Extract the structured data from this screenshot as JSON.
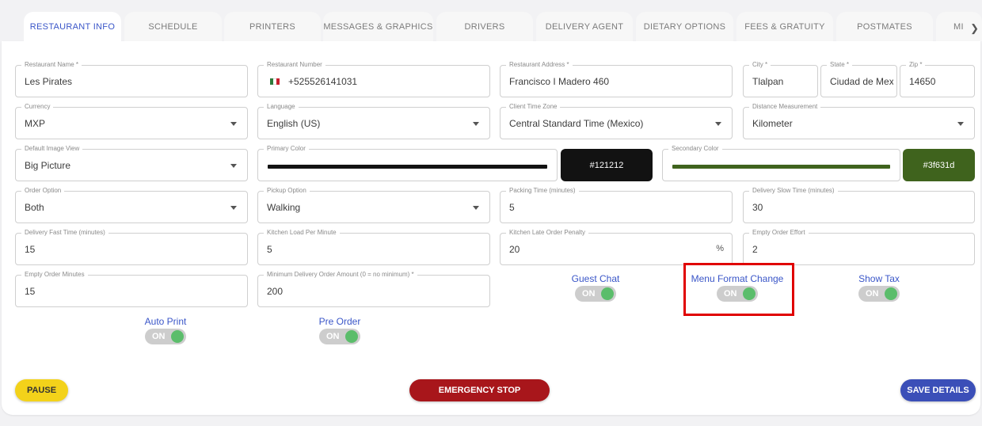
{
  "tabs": [
    {
      "label": "RESTAURANT INFO",
      "active": true
    },
    {
      "label": "SCHEDULE"
    },
    {
      "label": "PRINTERS"
    },
    {
      "label": "MESSAGES & GRAPHICS"
    },
    {
      "label": "DRIVERS"
    },
    {
      "label": "DELIVERY AGENT"
    },
    {
      "label": "DIETARY OPTIONS"
    },
    {
      "label": "FEES & GRATUITY"
    },
    {
      "label": "POSTMATES"
    },
    {
      "label": "MI"
    }
  ],
  "fields": {
    "restaurant_name": {
      "label": "Restaurant Name *",
      "value": "Les Pirates"
    },
    "restaurant_number": {
      "label": "Restaurant Number",
      "value": "+525526141031"
    },
    "restaurant_address": {
      "label": "Restaurant Address *",
      "value": "Francisco I Madero 460"
    },
    "city": {
      "label": "City *",
      "value": "Tlalpan"
    },
    "state": {
      "label": "State *",
      "value": "Ciudad de Mexi"
    },
    "zip": {
      "label": "Zip *",
      "value": "14650"
    },
    "currency": {
      "label": "Currency",
      "value": "MXP"
    },
    "language": {
      "label": "Language",
      "value": "English (US)"
    },
    "client_time_zone": {
      "label": "Client Time Zone",
      "value": "Central Standard Time (Mexico)"
    },
    "distance_measurement": {
      "label": "Distance Measurement",
      "value": "Kilometer"
    },
    "default_image_view": {
      "label": "Default Image View",
      "value": "Big Picture"
    },
    "primary_color": {
      "label": "Primary Color",
      "value": "#121212"
    },
    "secondary_color": {
      "label": "Secondary Color",
      "value": "#3f631d"
    },
    "order_option": {
      "label": "Order Option",
      "value": "Both"
    },
    "pickup_option": {
      "label": "Pickup Option",
      "value": "Walking"
    },
    "packing_time": {
      "label": "Packing Time (minutes)",
      "value": "5"
    },
    "delivery_slow_time": {
      "label": "Delivery Slow Time (minutes)",
      "value": "30"
    },
    "delivery_fast_time": {
      "label": "Delivery Fast Time (minutes)",
      "value": "15"
    },
    "kitchen_load_per_minute": {
      "label": "Kitchen Load Per Minute",
      "value": "5"
    },
    "kitchen_late_order_penalty": {
      "label": "Kitchen Late Order Penalty",
      "value": "20",
      "suffix": "%"
    },
    "empty_order_effort": {
      "label": "Empty Order Effort",
      "value": "2"
    },
    "empty_order_minutes": {
      "label": "Empty Order Minutes",
      "value": "15"
    },
    "minimum_delivery_order_amount": {
      "label": "Minimum Delivery Order Amount (0 = no minimum) *",
      "value": "200"
    }
  },
  "toggles": {
    "guest_chat": {
      "label": "Guest Chat",
      "state": "ON"
    },
    "menu_format_change": {
      "label": "Menu Format Change",
      "state": "ON"
    },
    "show_tax": {
      "label": "Show Tax",
      "state": "ON"
    },
    "auto_print": {
      "label": "Auto Print",
      "state": "ON"
    },
    "pre_order": {
      "label": "Pre Order",
      "state": "ON"
    }
  },
  "buttons": {
    "pause": "PAUSE",
    "emergency_stop": "EMERGENCY STOP",
    "save_details": "SAVE DETAILS"
  },
  "colors": {
    "accent": "#3a56c8",
    "primary_swatch": "#121212",
    "secondary_swatch": "#3f631d",
    "toggle_on": "#5bbd6b",
    "pause_button": "#f3d21a",
    "emergency_button": "#a8161b",
    "save_button": "#3b4fb8",
    "highlight_box": "#e00000"
  },
  "icons": {
    "tab_scroll": "chevron-right-icon",
    "phone_country": "mexico-flag-icon",
    "select": "caret-down-icon"
  }
}
